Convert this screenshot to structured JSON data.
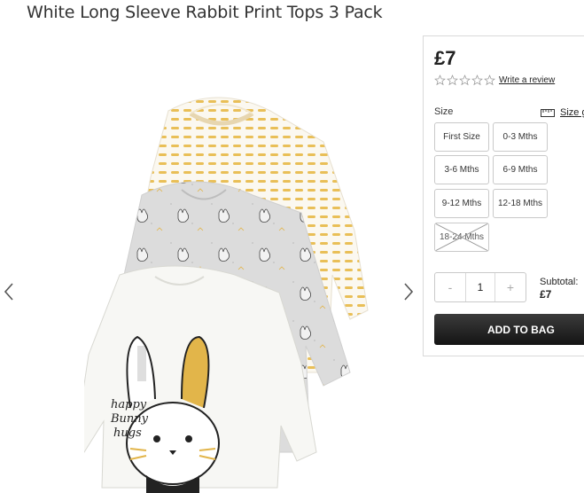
{
  "product": {
    "title": "White Long Sleeve Rabbit Print Tops 3 Pack",
    "price": "£7",
    "rating_stars": 0,
    "review_link": "Write a review"
  },
  "gallery": {
    "prev_icon": "chevron-left-icon",
    "next_icon": "chevron-right-icon",
    "image_text": [
      "happy",
      "Bunny",
      "hugs"
    ]
  },
  "size": {
    "label": "Size",
    "guide_label": "Size guide",
    "guide_icon": "ruler-icon",
    "options": [
      {
        "label": "First Size",
        "available": true
      },
      {
        "label": "0-3 Mths",
        "available": true
      },
      {
        "label": "3-6 Mths",
        "available": true
      },
      {
        "label": "6-9 Mths",
        "available": true
      },
      {
        "label": "9-12 Mths",
        "available": true
      },
      {
        "label": "12-18 Mths",
        "available": true
      },
      {
        "label": "18-24 Mths",
        "available": false
      }
    ]
  },
  "quantity": {
    "minus": "-",
    "value": "1",
    "plus": "+"
  },
  "subtotal": {
    "label": "Subtotal:",
    "amount": "£7"
  },
  "actions": {
    "add_to_bag": "ADD TO BAG"
  },
  "colors": {
    "button_dark": "#1a1a1a",
    "border": "#c9c9c9",
    "mustard": "#e2b54a"
  }
}
